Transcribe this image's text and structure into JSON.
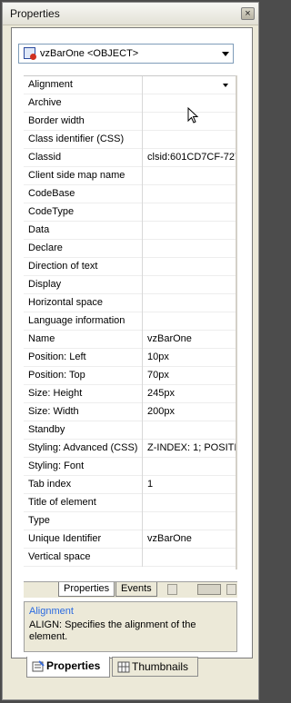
{
  "window": {
    "title": "Properties",
    "close_glyph": "×"
  },
  "object_selector": {
    "value": "vzBarOne <OBJECT>"
  },
  "properties": [
    {
      "name": "Alignment",
      "value": ""
    },
    {
      "name": "Archive",
      "value": ""
    },
    {
      "name": "Border width",
      "value": ""
    },
    {
      "name": "Class identifier (CSS)",
      "value": ""
    },
    {
      "name": "Classid",
      "value": "clsid:601CD7CF-727"
    },
    {
      "name": "Client side map name",
      "value": ""
    },
    {
      "name": "CodeBase",
      "value": ""
    },
    {
      "name": "CodeType",
      "value": ""
    },
    {
      "name": "Data",
      "value": ""
    },
    {
      "name": "Declare",
      "value": ""
    },
    {
      "name": "Direction of text",
      "value": ""
    },
    {
      "name": "Display",
      "value": ""
    },
    {
      "name": "Horizontal space",
      "value": ""
    },
    {
      "name": "Language information",
      "value": ""
    },
    {
      "name": "Name",
      "value": "vzBarOne"
    },
    {
      "name": "Position: Left",
      "value": "10px"
    },
    {
      "name": "Position: Top",
      "value": "70px"
    },
    {
      "name": "Size: Height",
      "value": "245px"
    },
    {
      "name": "Size: Width",
      "value": "200px"
    },
    {
      "name": "Standby",
      "value": ""
    },
    {
      "name": "Styling: Advanced (CSS)",
      "value": "Z-INDEX: 1; POSITI"
    },
    {
      "name": "Styling: Font",
      "value": ""
    },
    {
      "name": "Tab index",
      "value": "1"
    },
    {
      "name": "Title of element",
      "value": ""
    },
    {
      "name": "Type",
      "value": ""
    },
    {
      "name": "Unique Identifier",
      "value": "vzBarOne"
    },
    {
      "name": "Vertical space",
      "value": ""
    }
  ],
  "inner_tabs": {
    "properties": "Properties",
    "events": "Events"
  },
  "description": {
    "title": "Alignment",
    "text": "ALIGN: Specifies the alignment of the element."
  },
  "pane_tabs": {
    "properties": "Properties",
    "thumbnails": "Thumbnails"
  },
  "icons": [
    "close-icon",
    "object-icon",
    "dropdown-arrow-icon",
    "mouse-pointer-icon",
    "scroll-left-icon",
    "scroll-right-icon",
    "properties-icon",
    "thumbnails-icon"
  ]
}
